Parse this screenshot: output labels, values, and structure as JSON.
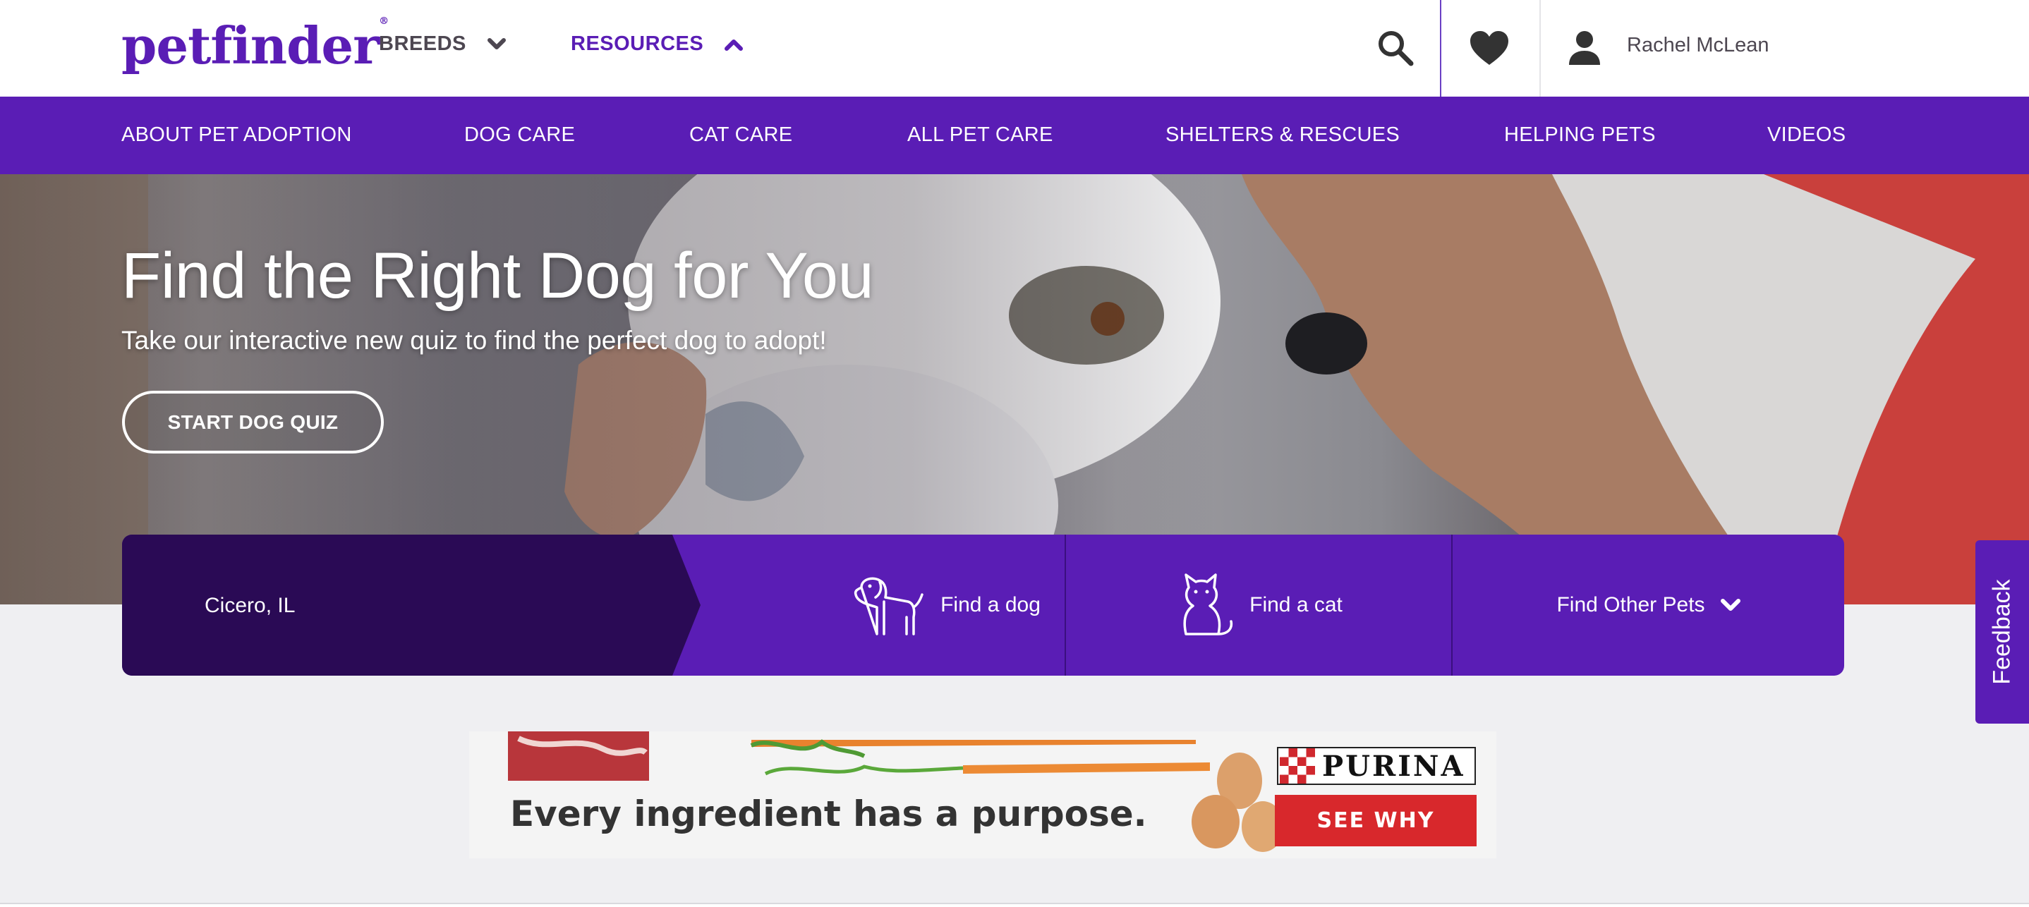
{
  "header": {
    "logo": "petfinder",
    "nav": [
      {
        "label": "BREEDS",
        "icon": "chevron-down-icon"
      },
      {
        "label": "RESOURCES",
        "icon": "chevron-up-icon"
      }
    ],
    "user_name": "Rachel McLean"
  },
  "subnav": {
    "items": [
      "ABOUT PET ADOPTION",
      "DOG CARE",
      "CAT CARE",
      "ALL PET CARE",
      "SHELTERS & RESCUES",
      "HELPING PETS",
      "VIDEOS"
    ]
  },
  "hero": {
    "title": "Find the Right Dog for You",
    "subtitle": "Take our interactive new quiz to find the perfect dog to adopt!",
    "cta": "START DOG QUIZ"
  },
  "search": {
    "location": "Cicero, IL",
    "find_dog": "Find a dog",
    "find_cat": "Find a cat",
    "find_other": "Find Other Pets"
  },
  "feedback": "Feedback",
  "ad": {
    "headline": "Every ingredient has a purpose.",
    "brand": "PURINA",
    "cta": "SEE WHY"
  },
  "colors": {
    "brand_purple": "#5a1db5",
    "location_panel": "#2a0a55",
    "ad_red": "#d8282c"
  }
}
